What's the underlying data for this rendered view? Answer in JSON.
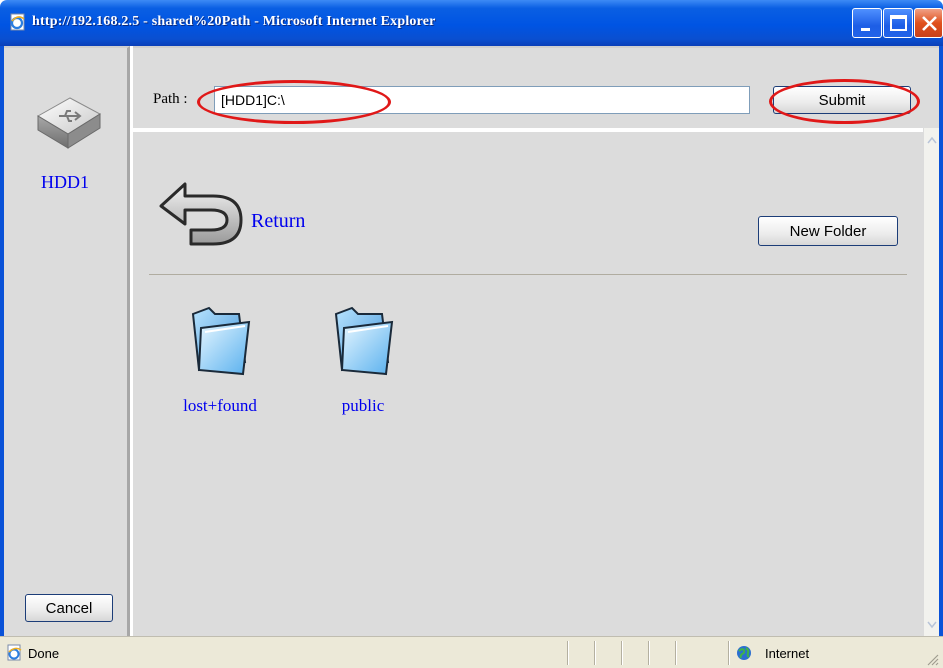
{
  "window": {
    "title": "http://192.168.2.5 - shared%20Path - Microsoft Internet Explorer"
  },
  "sidebar": {
    "drive_label": "HDD1",
    "cancel_label": "Cancel"
  },
  "pathbar": {
    "label": "Path :",
    "value": "[HDD1]C:\\",
    "submit_label": "Submit"
  },
  "content": {
    "return_label": "Return",
    "new_folder_label": "New Folder",
    "folders": [
      {
        "name": "lost+found"
      },
      {
        "name": "public"
      }
    ]
  },
  "statusbar": {
    "status": "Done",
    "zone": "Internet"
  },
  "annotations": {
    "highlight_color": "#e01818"
  },
  "icons": {
    "title_icon": "ie-page-icon",
    "drive_icon": "usb-drive-icon",
    "return_icon": "return-arrow-icon",
    "folder_icon": "folder-icon",
    "status_icon": "ie-page-icon",
    "zone_icon": "globe-icon"
  }
}
